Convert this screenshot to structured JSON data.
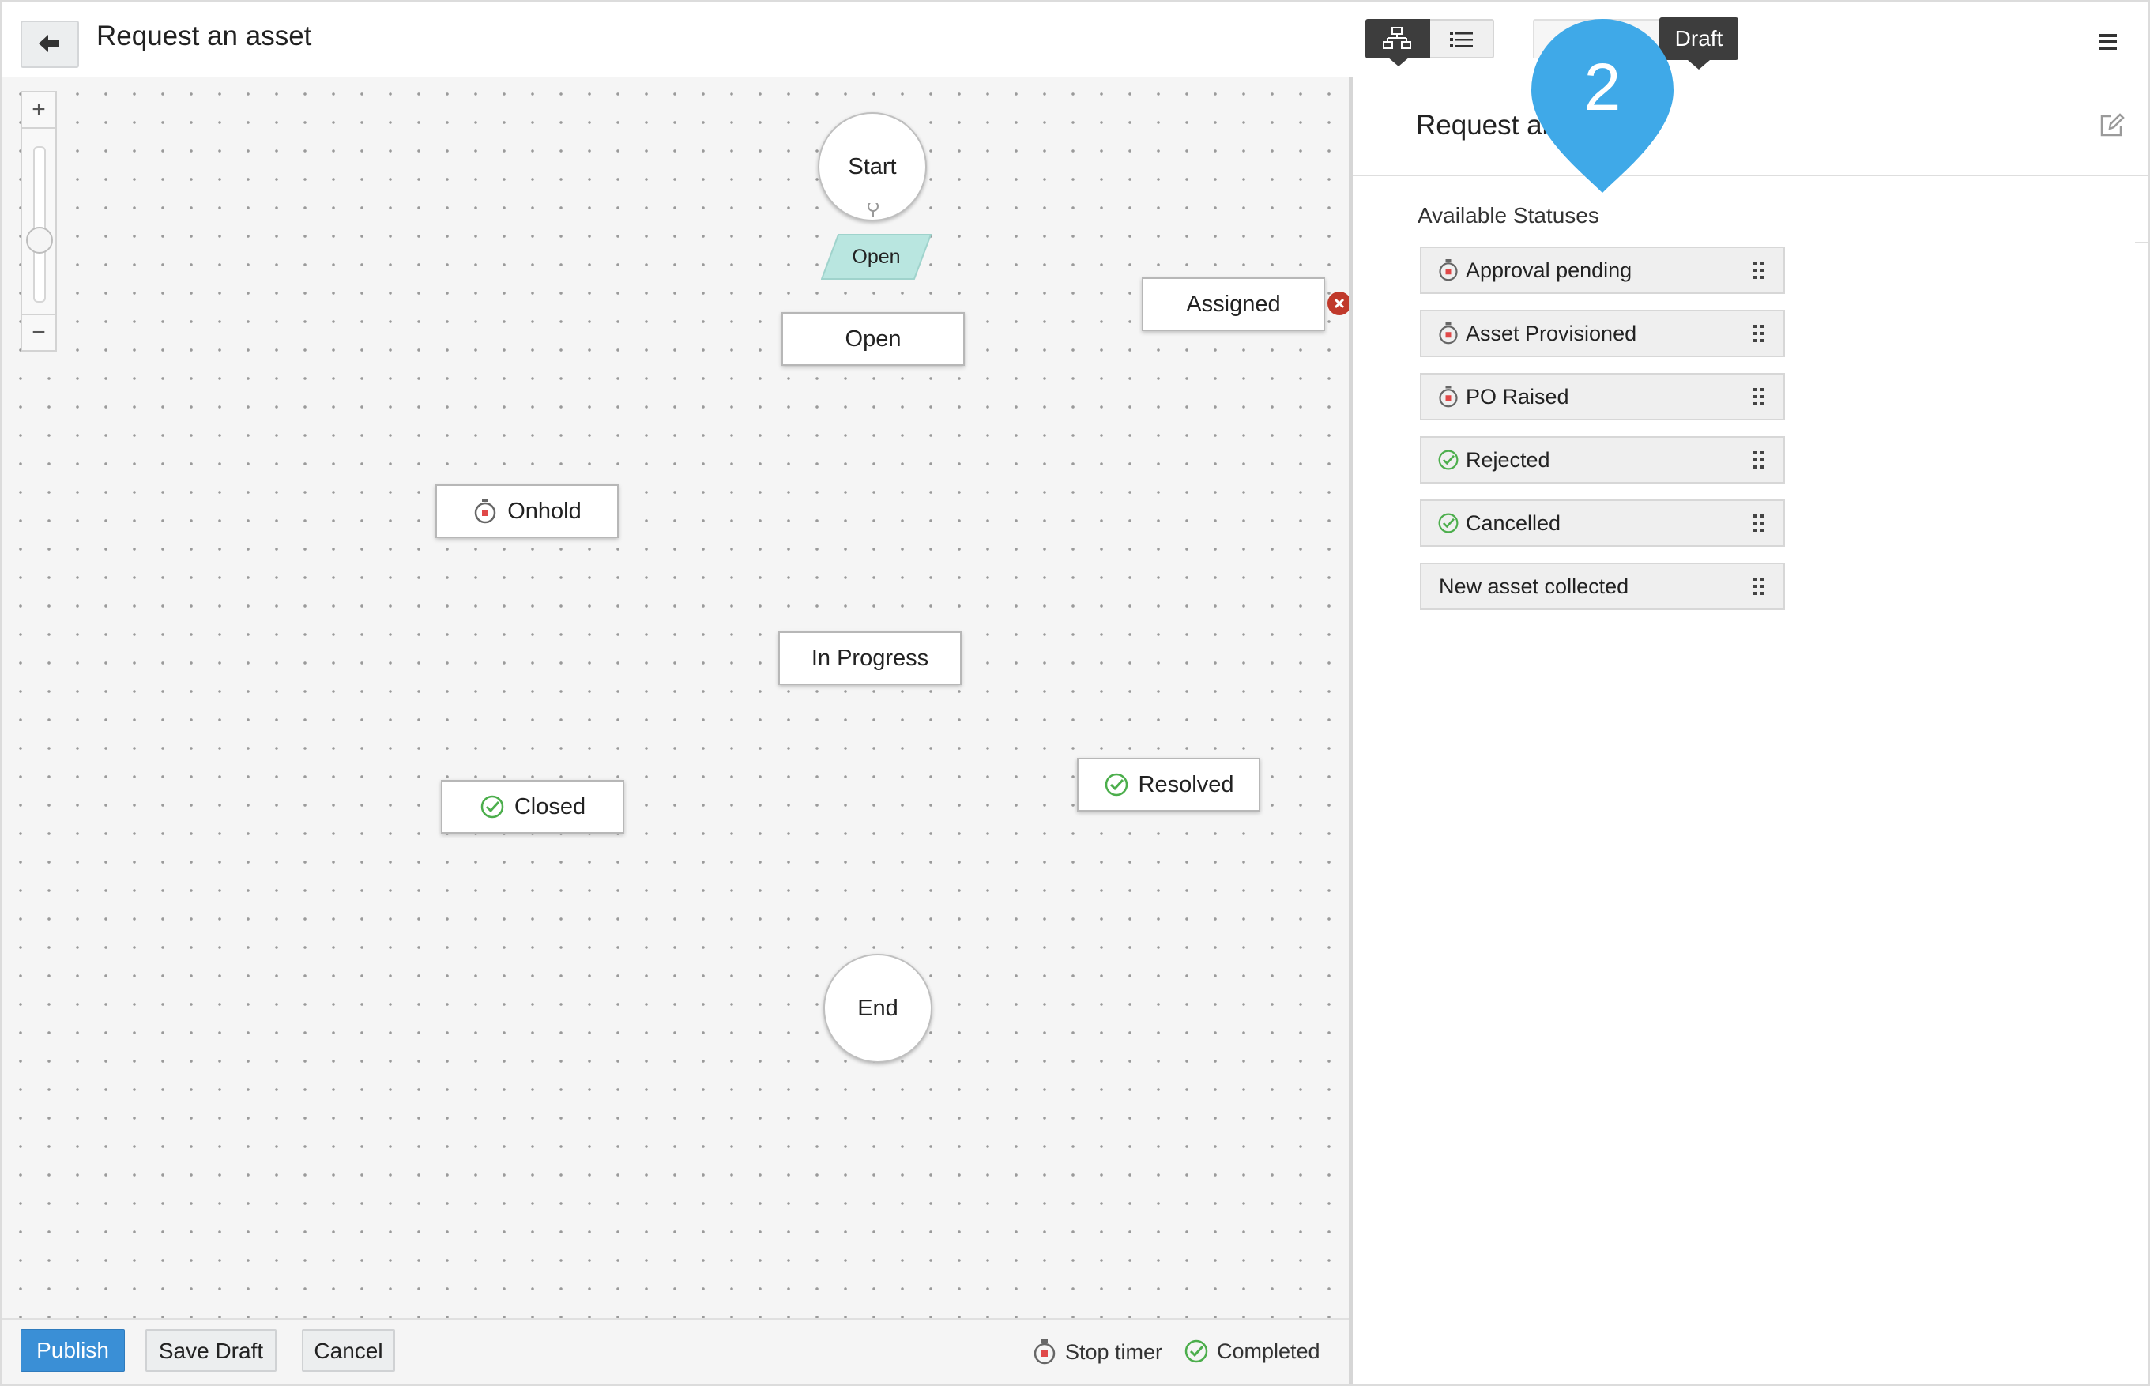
{
  "header": {
    "title": "Request an asset",
    "badge": "Draft",
    "callout_number": "2"
  },
  "icons": {
    "back": "arrow-left-icon",
    "flow_view": "flowchart-icon",
    "list_view": "list-icon",
    "menu": "hamburger-menu-icon",
    "edit": "edit-icon",
    "stop_timer": "stopwatch-icon",
    "completed": "check-circle-icon",
    "delete": "close-icon",
    "drag": "drag-handle-icon"
  },
  "canvas": {
    "zoom_in": "+",
    "zoom_out": "−",
    "start": "Start",
    "end": "End",
    "transition": "Open",
    "nodes": {
      "open": "Open",
      "assigned": "Assigned",
      "onhold": "Onhold",
      "in_progress": "In Progress",
      "closed": "Closed",
      "resolved": "Resolved"
    }
  },
  "footer": {
    "publish": "Publish",
    "save_draft": "Save Draft",
    "cancel": "Cancel",
    "legend_stop_timer": "Stop timer",
    "legend_completed": "Completed"
  },
  "panel": {
    "title": "Request an asset",
    "section_title": "Available Statuses",
    "statuses": [
      {
        "label": "Approval pending",
        "type": "stop-timer"
      },
      {
        "label": "Asset Provisioned",
        "type": "stop-timer"
      },
      {
        "label": "PO Raised",
        "type": "stop-timer"
      },
      {
        "label": "Rejected",
        "type": "completed"
      },
      {
        "label": "Cancelled",
        "type": "completed"
      },
      {
        "label": "New asset collected",
        "type": "none"
      }
    ]
  },
  "colors": {
    "accent": "#3a8fd6",
    "callout": "#3fa9e8",
    "stop_timer": "#e04848",
    "completed": "#4cae4c",
    "transition_fill": "#b9e6e0",
    "delete": "#c0392b",
    "dark_toggle": "#3d3d3d"
  }
}
